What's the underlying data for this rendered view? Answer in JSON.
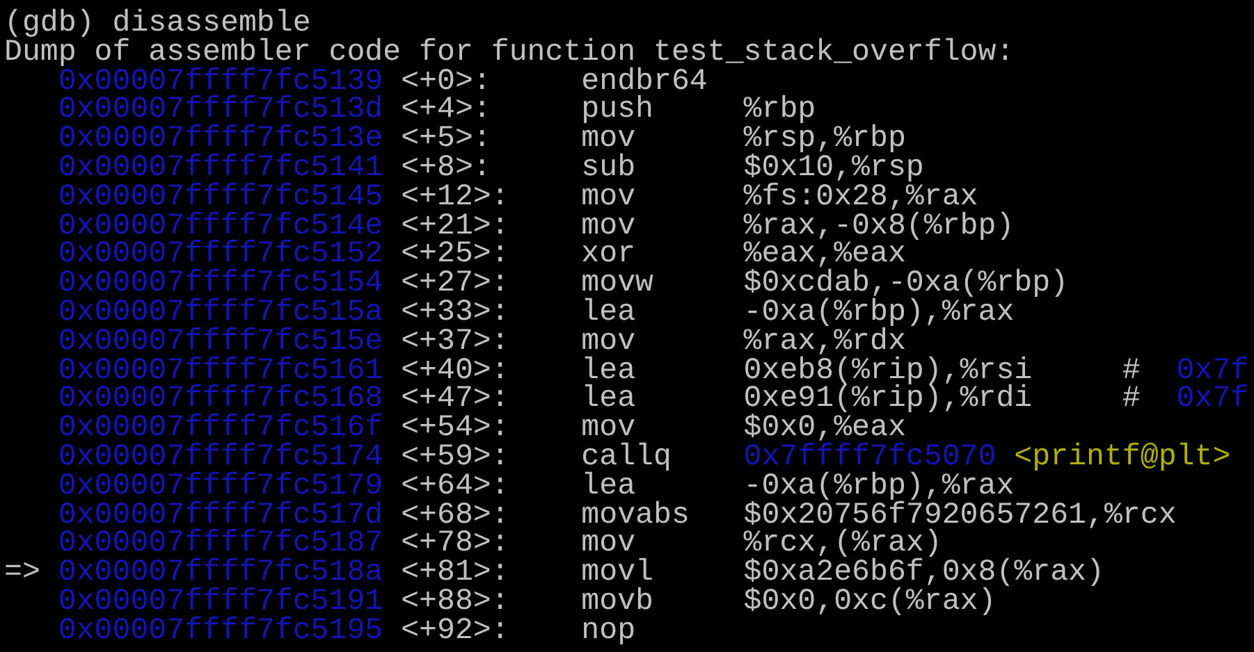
{
  "prompt": "(gdb) disassemble",
  "header": "Dump of assembler code for function test_stack_overflow:",
  "lines": [
    {
      "address": "0x00007ffff7fc5139",
      "offset": "<+0>:",
      "mnemonic": "endbr64"
    },
    {
      "address": "0x00007ffff7fc513d",
      "offset": "<+4>:",
      "mnemonic": "push",
      "operands": "%rbp"
    },
    {
      "address": "0x00007ffff7fc513e",
      "offset": "<+5>:",
      "mnemonic": "mov",
      "operands": "%rsp,%rbp"
    },
    {
      "address": "0x00007ffff7fc5141",
      "offset": "<+8>:",
      "mnemonic": "sub",
      "operands": "$0x10,%rsp"
    },
    {
      "address": "0x00007ffff7fc5145",
      "offset": "<+12>:",
      "mnemonic": "mov",
      "operands": "%fs:0x28,%rax"
    },
    {
      "address": "0x00007ffff7fc514e",
      "offset": "<+21>:",
      "mnemonic": "mov",
      "operands": "%rax,-0x8(%rbp)"
    },
    {
      "address": "0x00007ffff7fc5152",
      "offset": "<+25>:",
      "mnemonic": "xor",
      "operands": "%eax,%eax"
    },
    {
      "address": "0x00007ffff7fc5154",
      "offset": "<+27>:",
      "mnemonic": "movw",
      "operands": "$0xcdab,-0xa(%rbp)"
    },
    {
      "address": "0x00007ffff7fc515a",
      "offset": "<+33>:",
      "mnemonic": "lea",
      "operands": "-0xa(%rbp),%rax"
    },
    {
      "address": "0x00007ffff7fc515e",
      "offset": "<+37>:",
      "mnemonic": "mov",
      "operands": "%rax,%rdx"
    },
    {
      "address": "0x00007ffff7fc5161",
      "offset": "<+40>:",
      "mnemonic": "lea",
      "operands": "0xeb8(%rip),%rsi",
      "comment": {
        "mark": "#",
        "address": "0x7f"
      }
    },
    {
      "address": "0x00007ffff7fc5168",
      "offset": "<+47>:",
      "mnemonic": "lea",
      "operands": "0xe91(%rip),%rdi",
      "comment": {
        "mark": "#",
        "address": "0x7f"
      }
    },
    {
      "address": "0x00007ffff7fc516f",
      "offset": "<+54>:",
      "mnemonic": "mov",
      "operands": "$0x0,%eax"
    },
    {
      "address": "0x00007ffff7fc5174",
      "offset": "<+59>:",
      "mnemonic": "callq",
      "target": "0x7ffff7fc5070",
      "symbol": "<printf@plt>"
    },
    {
      "address": "0x00007ffff7fc5179",
      "offset": "<+64>:",
      "mnemonic": "lea",
      "operands": "-0xa(%rbp),%rax"
    },
    {
      "address": "0x00007ffff7fc517d",
      "offset": "<+68>:",
      "mnemonic": "movabs",
      "operands": "$0x20756f7920657261,%rcx"
    },
    {
      "address": "0x00007ffff7fc5187",
      "offset": "<+78>:",
      "mnemonic": "mov",
      "operands": "%rcx,(%rax)"
    },
    {
      "marker": "=>",
      "address": "0x00007ffff7fc518a",
      "offset": "<+81>:",
      "mnemonic": "movl",
      "operands": "$0xa2e6b6f,0x8(%rax)"
    },
    {
      "address": "0x00007ffff7fc5191",
      "offset": "<+88>:",
      "mnemonic": "movb",
      "operands": "$0x0,0xc(%rax)"
    },
    {
      "address": "0x00007ffff7fc5195",
      "offset": "<+92>:",
      "mnemonic": "nop"
    }
  ]
}
